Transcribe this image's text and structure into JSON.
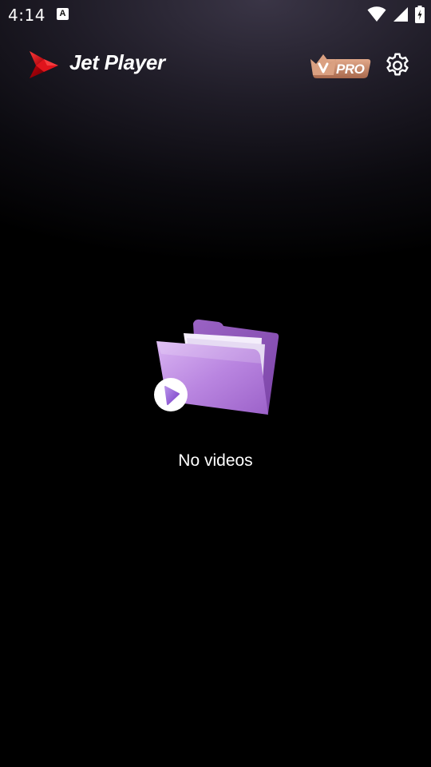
{
  "status_bar": {
    "time": "4:14",
    "notification_icon": "a-icon",
    "wifi_icon": "wifi-icon",
    "signal_icon": "cell-signal-icon",
    "battery_icon": "battery-charging-icon"
  },
  "app_bar": {
    "title": "Jet Player",
    "logo_icon": "jet-player-logo",
    "pro_badge_label": "PRO",
    "pro_badge_icon": "crown-icon",
    "settings_icon": "gear-icon"
  },
  "empty_state": {
    "illustration_icon": "video-folder-icon",
    "message": "No videos"
  },
  "colors": {
    "background": "#000000",
    "header_glow": "#3a3546",
    "logo_red": "#e0141c",
    "folder_purple": "#b07fd6",
    "pro_badge": "#c98a6a",
    "text": "#ffffff"
  }
}
